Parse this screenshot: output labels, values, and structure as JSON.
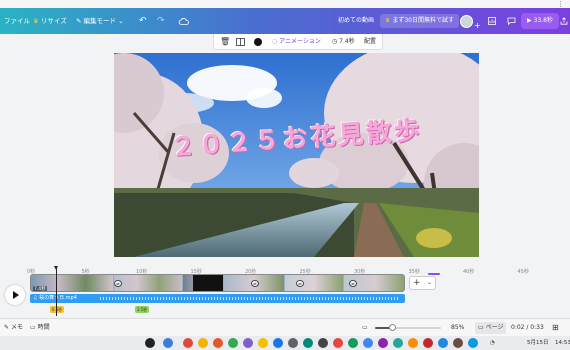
{
  "topbar": {
    "file_label": "ファイル",
    "resize_label": "リサイズ",
    "edit_mode_label": "編集モード",
    "doc_title": "初めての動画",
    "trial_label": "まず30日間無料で試す",
    "share_label": "33.8秒"
  },
  "context_toolbar": {
    "animation_label": "アニメーション",
    "duration_label": "7.4秒",
    "position_label": "配置"
  },
  "canvas": {
    "overlay_title": "２０２５お花見散歩"
  },
  "timeline": {
    "ruler_ticks": [
      "0秒",
      "5秒",
      "10秒",
      "15秒",
      "20秒",
      "25秒",
      "30秒",
      "35秒",
      "40秒",
      "45秒"
    ],
    "first_clip_duration": "7.4秒",
    "audio_track_label": "桜の舞う日.mp4",
    "marker_1": "0.5秒",
    "marker_2": "1.5秒"
  },
  "bottom_bar": {
    "notes_label": "メモ",
    "timer_label": "時間",
    "zoom_value": "85%",
    "zoom_fraction": 0.85,
    "page_label": "ページ",
    "time_display": "0:02 / 0:33"
  },
  "system_tray": {
    "date": "5月15日",
    "time": "14:53"
  },
  "colors": {
    "topbar_start": "#2ab3c4",
    "topbar_end": "#7b3fe0",
    "accent_purple": "#8f4de8",
    "audio_track": "#2f9cf5",
    "title_pink": "#f6a8d8"
  }
}
